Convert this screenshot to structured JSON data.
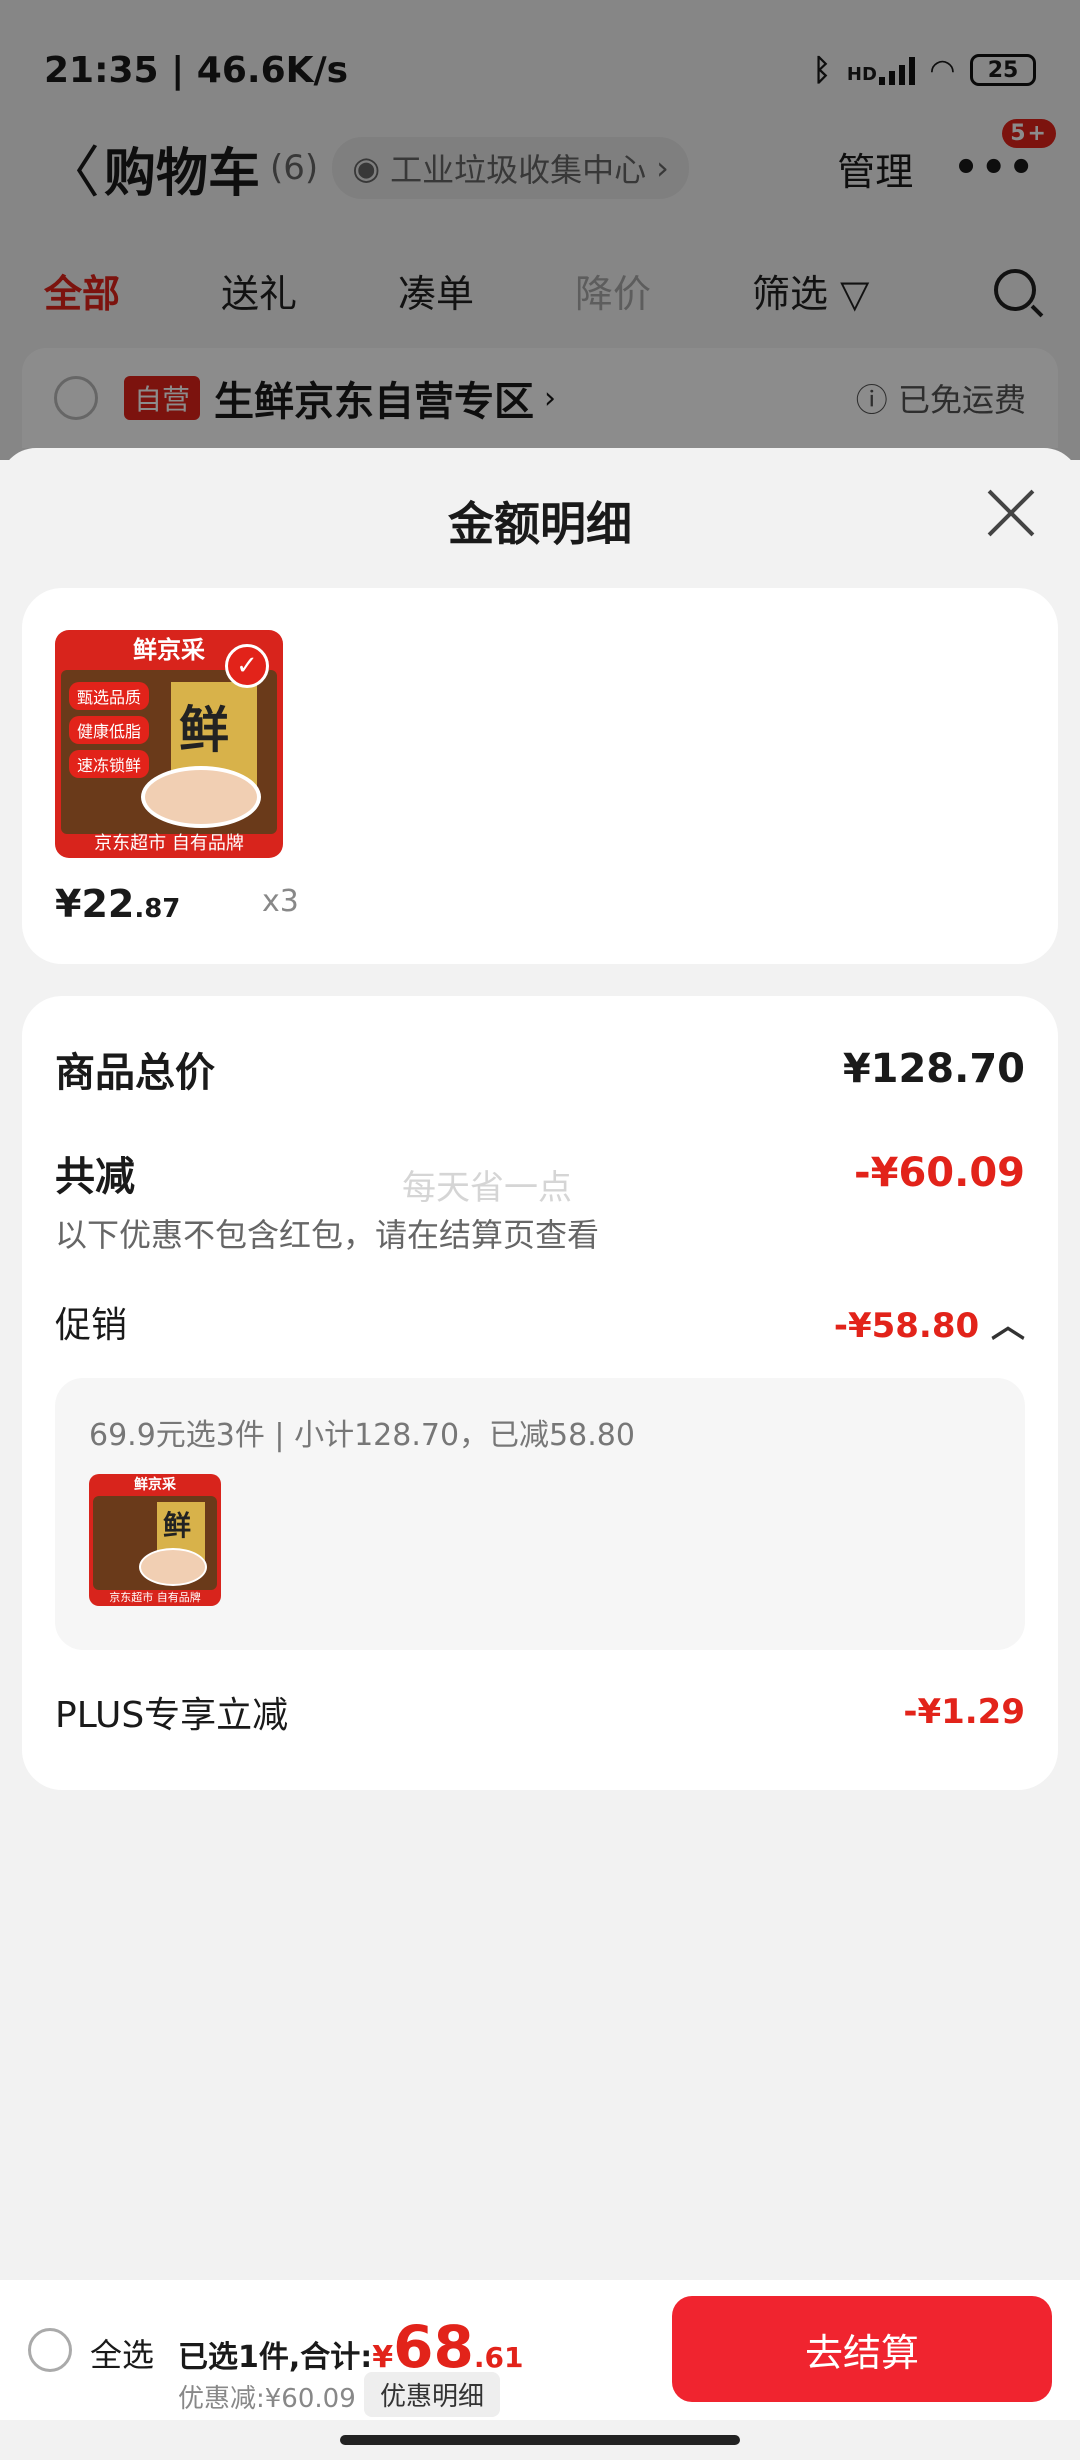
{
  "status": {
    "time_speed": "21:35 | 46.6K/s",
    "battery": "25",
    "signal_label": "HD"
  },
  "header": {
    "title": "购物车",
    "count": "(6)",
    "location": "工业垃圾收集中心",
    "manage": "管理",
    "badge": "5+"
  },
  "tabs": [
    {
      "label": "全部",
      "state": "active"
    },
    {
      "label": "送礼",
      "state": "normal"
    },
    {
      "label": "凑单",
      "state": "normal"
    },
    {
      "label": "降价",
      "state": "disabled"
    },
    {
      "label": "筛选",
      "state": "normal"
    }
  ],
  "shop": {
    "tag": "自营",
    "name": "生鲜京东自营专区",
    "shipping": "已免运费"
  },
  "sheet": {
    "title": "金额明细",
    "product": {
      "brand_top": "鲜京采",
      "brand_bottom": "京东超市 自有品牌",
      "badge_char": "鲜",
      "tags": [
        "甄选品质",
        "健康低脂",
        "速冻锁鲜"
      ],
      "price_int": "¥22",
      "price_dec": ".87",
      "qty": "x3"
    },
    "summary": {
      "total_label": "商品总价",
      "total_value": "¥128.70",
      "reduce_label": "共减",
      "reduce_value": "-¥60.09",
      "note": "以下优惠不包含红包，请在结算页查看",
      "watermark": "每天省一点",
      "promo_label": "促销",
      "promo_value": "-¥58.80",
      "promo_detail": "69.9元选3件 | 小计128.70，已减58.80",
      "plus_label": "PLUS专享立减",
      "plus_value": "-¥1.29"
    }
  },
  "bottom": {
    "select_all": "全选",
    "selected": "已选1件,合计:",
    "currency": "¥",
    "total_int": "68",
    "total_dec": ".61",
    "discount": "优惠减:¥60.09",
    "detail_button": "优惠明细",
    "checkout": "去结算"
  },
  "colors": {
    "accent": "#e2231a",
    "checkout": "#f0242f"
  }
}
